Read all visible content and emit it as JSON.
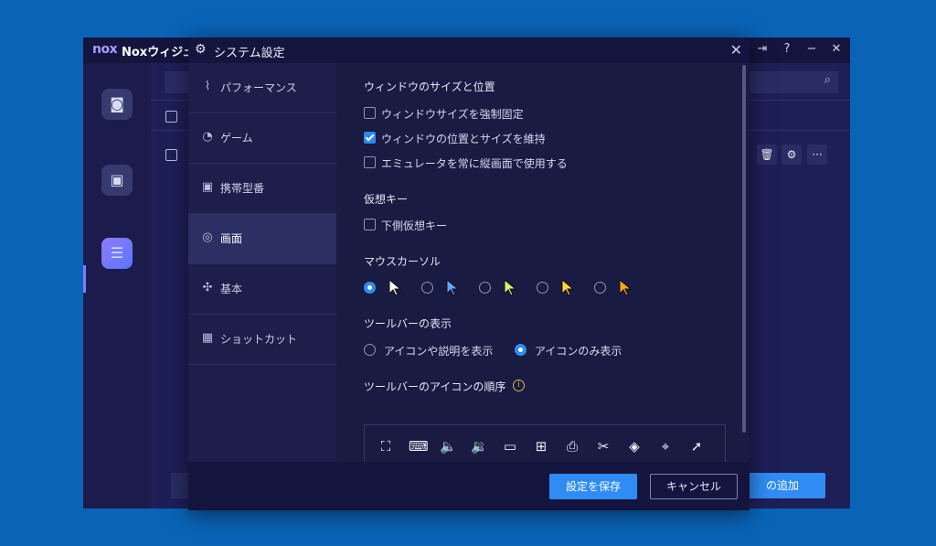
{
  "background_window": {
    "logo": "nox",
    "title": "Noxウィジュ",
    "controls": [
      "share-icon",
      "help-icon",
      "minimize-icon",
      "close-icon"
    ],
    "add_button_label": "の追加",
    "row_buttons": [
      "trash-icon",
      "gear-icon",
      "more-icon"
    ],
    "more_label": "···"
  },
  "dialog": {
    "title": "システム設定",
    "close_label": "✕",
    "nav": [
      {
        "label": "パフォーマンス",
        "icon": "activity-icon",
        "glyph": "⌇"
      },
      {
        "label": "ゲーム",
        "icon": "gamepad-icon",
        "glyph": "◔"
      },
      {
        "label": "携帯型番",
        "icon": "phone-icon",
        "glyph": "▣"
      },
      {
        "label": "画面",
        "icon": "palette-icon",
        "glyph": "◎"
      },
      {
        "label": "基本",
        "icon": "puzzle-icon",
        "glyph": "✣"
      },
      {
        "label": "ショットカット",
        "icon": "keyboard-icon",
        "glyph": "▦"
      }
    ],
    "active_nav": "画面",
    "sections": {
      "window": {
        "title": "ウィンドウのサイズと位置",
        "options": [
          {
            "label": "ウィンドウサイズを強制固定",
            "checked": false
          },
          {
            "label": "ウィンドウの位置とサイズを維持",
            "checked": true
          },
          {
            "label": "エミュレータを常に縦画面で使用する",
            "checked": false
          }
        ]
      },
      "virtual_keys": {
        "title": "仮想キー",
        "options": [
          {
            "label": "下側仮想キー",
            "checked": false
          }
        ]
      },
      "mouse_cursor": {
        "title": "マウスカーソル",
        "selected_index": 0,
        "cursor_colors": [
          "#ffffff",
          "#5fa8ff",
          "#d9f07a",
          "#ffd93a",
          "#f5a623"
        ]
      },
      "toolbar_display": {
        "title": "ツールバーの表示",
        "options": [
          {
            "label": "アイコンや説明を表示",
            "selected": false
          },
          {
            "label": "アイコンのみ表示",
            "selected": true
          }
        ]
      },
      "toolbar_order": {
        "title": "ツールバーのアイコンの順序",
        "info_glyph": "i",
        "icons_row1": [
          {
            "name": "fullscreen-icon",
            "glyph": "⛶"
          },
          {
            "name": "keyboard-icon",
            "glyph": "⌨"
          },
          {
            "name": "volume-up-icon",
            "glyph": "🔈"
          },
          {
            "name": "volume-down-icon",
            "glyph": "🔉"
          },
          {
            "name": "monitor-icon",
            "glyph": "▭"
          },
          {
            "name": "install-apk-icon",
            "glyph": "⊞"
          },
          {
            "name": "printer-icon",
            "glyph": "⎙"
          },
          {
            "name": "scissors-icon",
            "glyph": "✂"
          },
          {
            "name": "rotate-icon",
            "glyph": "◈"
          },
          {
            "name": "location-icon",
            "glyph": "⌖"
          },
          {
            "name": "rocket-icon",
            "glyph": "➚"
          }
        ],
        "icons_row2": [
          {
            "name": "loading-icon",
            "glyph": "✺"
          },
          {
            "name": "record-timer-icon",
            "glyph": "◷"
          },
          {
            "name": "video-record-icon",
            "glyph": "▶"
          },
          {
            "name": "sync-icon",
            "glyph": "⇆"
          },
          {
            "name": "menu-icon",
            "glyph": "≡"
          },
          {
            "name": "screenshot-icon",
            "glyph": "⊡"
          },
          {
            "name": "multi-window-icon",
            "glyph": "⧉"
          }
        ]
      }
    },
    "footer": {
      "save_label": "設定を保存",
      "cancel_label": "キャンセル"
    }
  }
}
